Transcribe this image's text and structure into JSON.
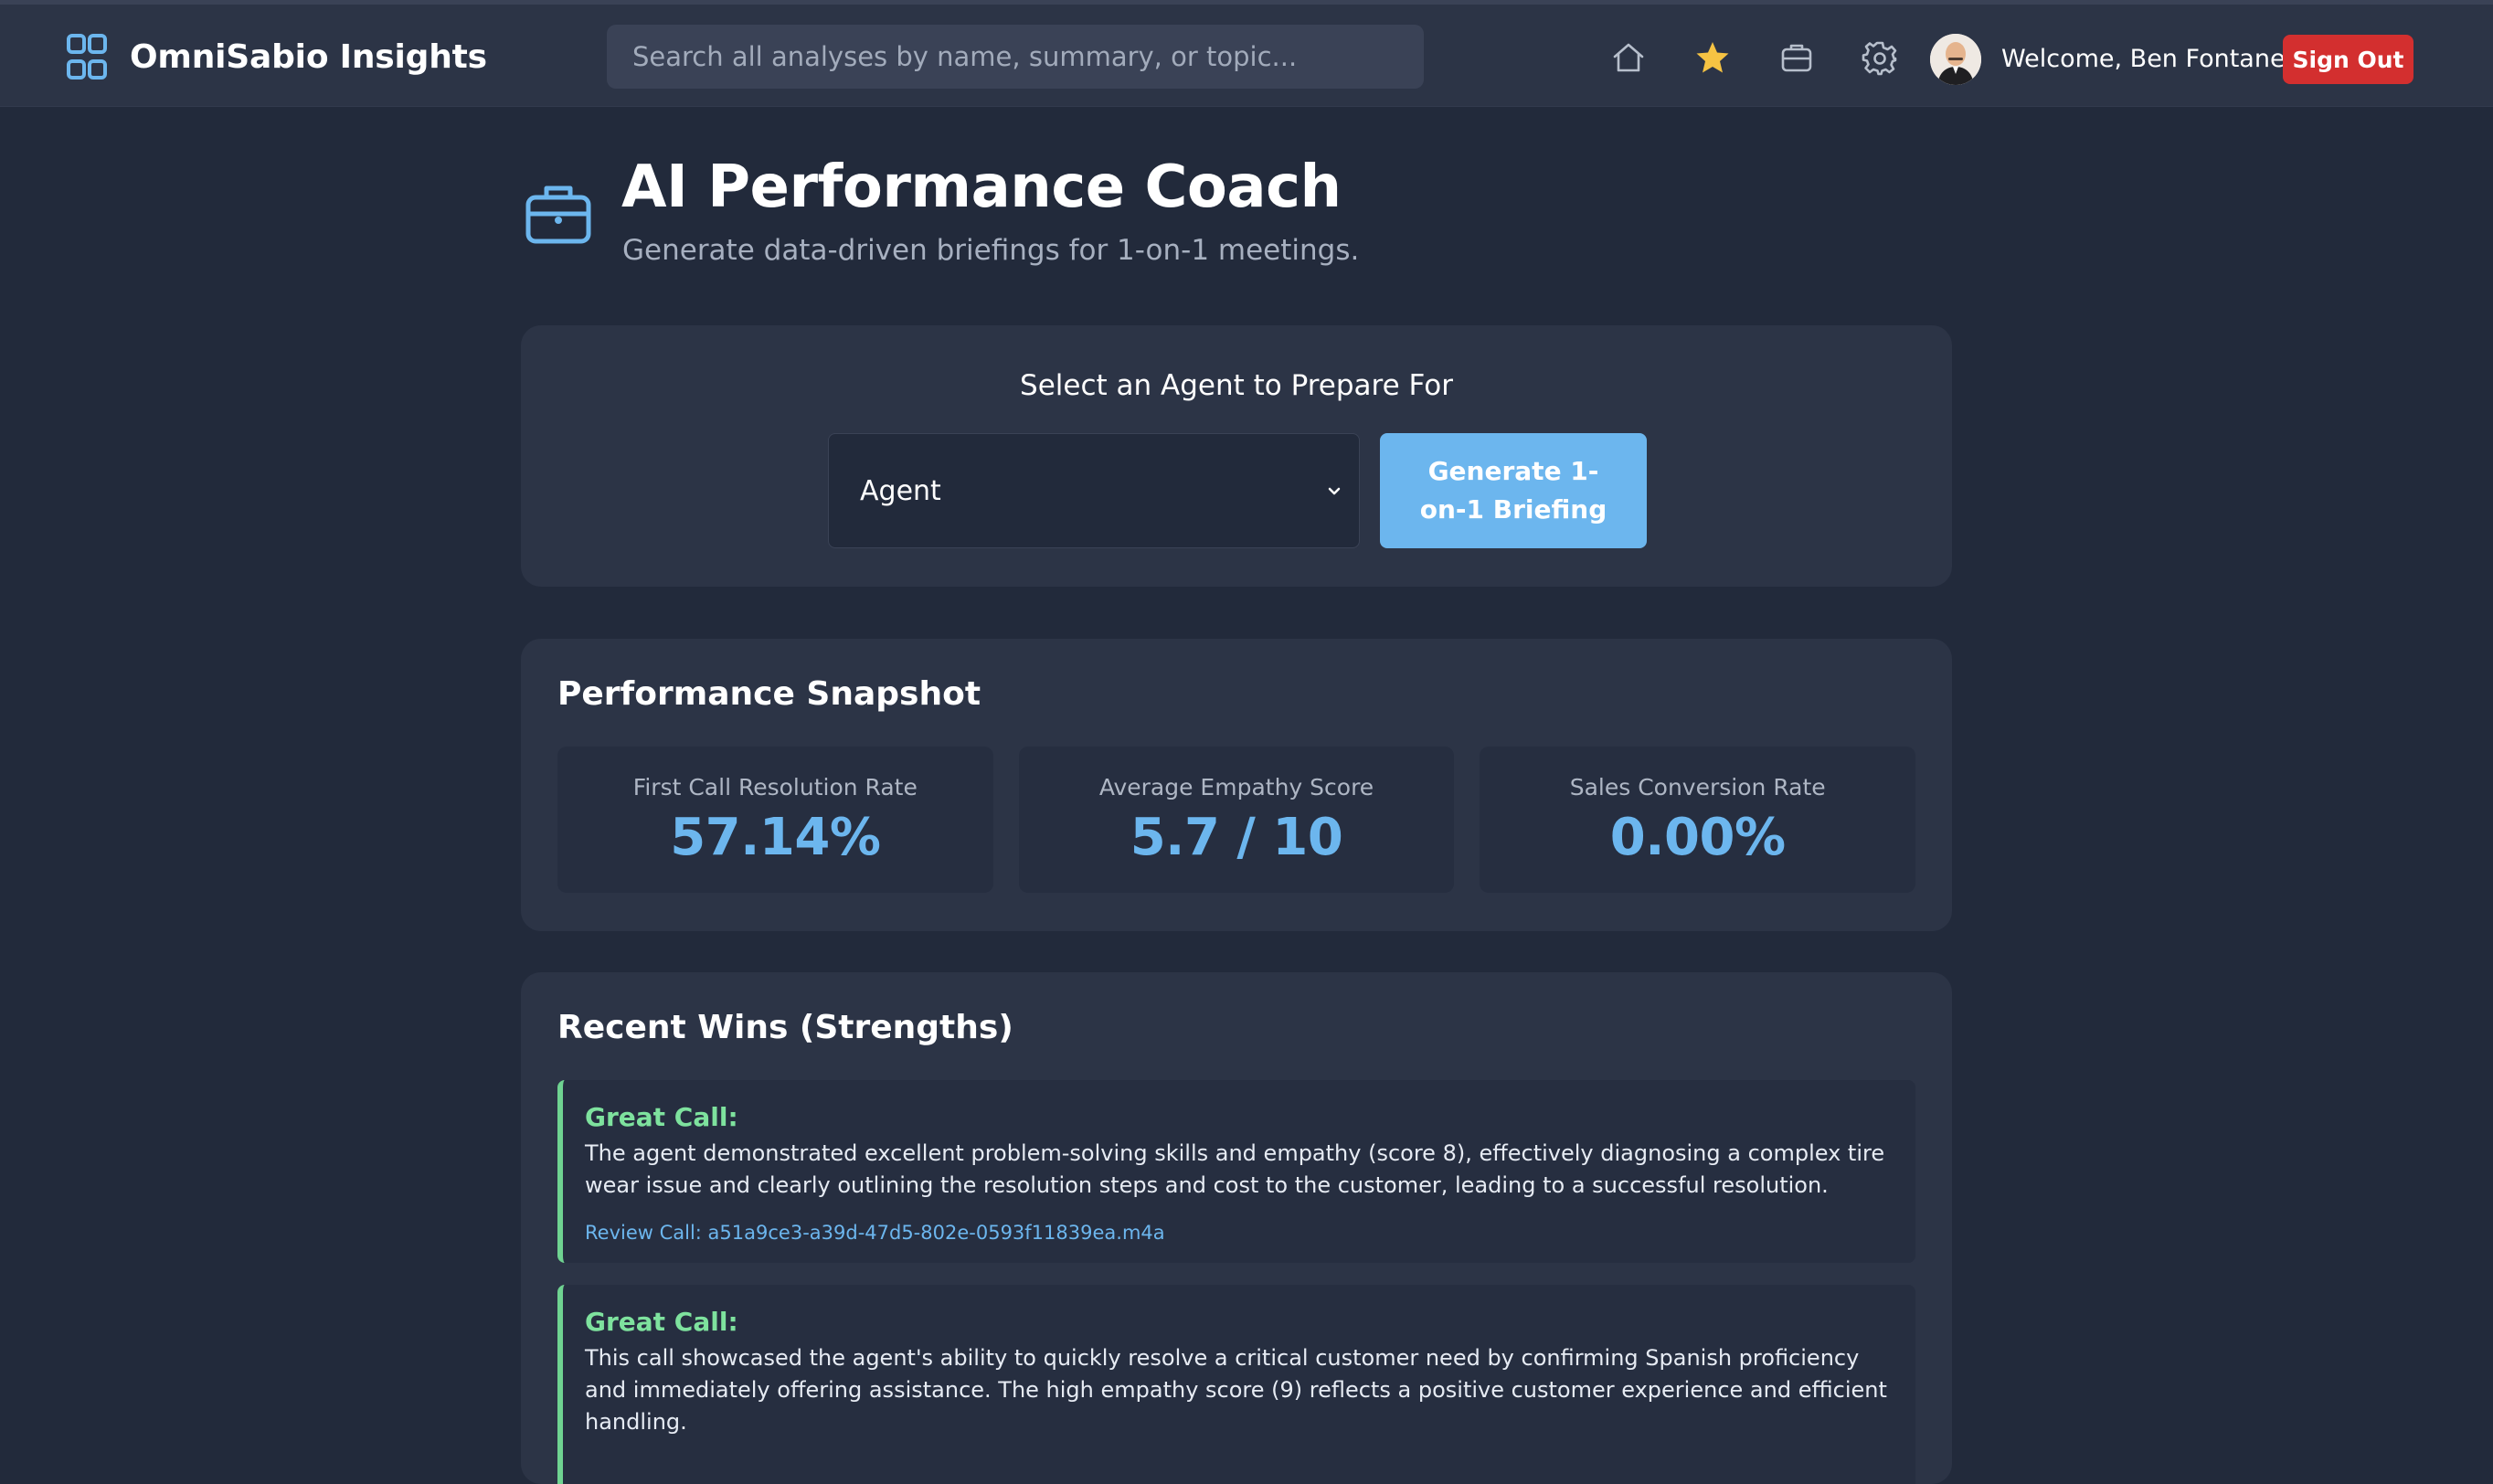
{
  "navbar": {
    "brand": "OmniSabio Insights",
    "search_placeholder": "Search all analyses by name, summary, or topic...",
    "welcome": "Welcome, Ben Fontanez",
    "sign_out": "Sign Out",
    "icons": [
      "home-icon",
      "star-icon",
      "briefcase-icon",
      "gear-icon"
    ],
    "star_color": "#f6c343"
  },
  "header": {
    "title": "AI Performance Coach",
    "subtitle": "Generate data-driven briefings for 1-on-1 meetings."
  },
  "agent_picker": {
    "heading": "Select an Agent to Prepare For",
    "selected": "Agent",
    "button": "Generate 1-on-1 Briefing"
  },
  "snapshot": {
    "title": "Performance Snapshot",
    "metrics": [
      {
        "label": "First Call Resolution Rate",
        "value": "57.14%"
      },
      {
        "label": "Average Empathy Score",
        "value": "5.7 / 10"
      },
      {
        "label": "Sales Conversion Rate",
        "value": "0.00%"
      }
    ]
  },
  "wins": {
    "title": "Recent Wins (Strengths)",
    "items": [
      {
        "title": "Great Call:",
        "text": "The agent demonstrated excellent problem-solving skills and empathy (score 8), effectively diagnosing a complex tire wear issue and clearly outlining the resolution steps and cost to the customer, leading to a successful resolution.",
        "link": "Review Call: a51a9ce3-a39d-47d5-802e-0593f11839ea.m4a"
      },
      {
        "title": "Great Call:",
        "text": "This call showcased the agent's ability to quickly resolve a critical customer need by confirming Spanish proficiency and immediately offering assistance. The high empathy score (9) reflects a positive customer experience and efficient handling.",
        "link": ""
      }
    ]
  },
  "colors": {
    "background": "#222a3b",
    "navbar": "#2c3446",
    "card": "#2c3446",
    "accent": "#6cb6ee",
    "success": "#7ee29e",
    "danger": "#d32f2f"
  }
}
